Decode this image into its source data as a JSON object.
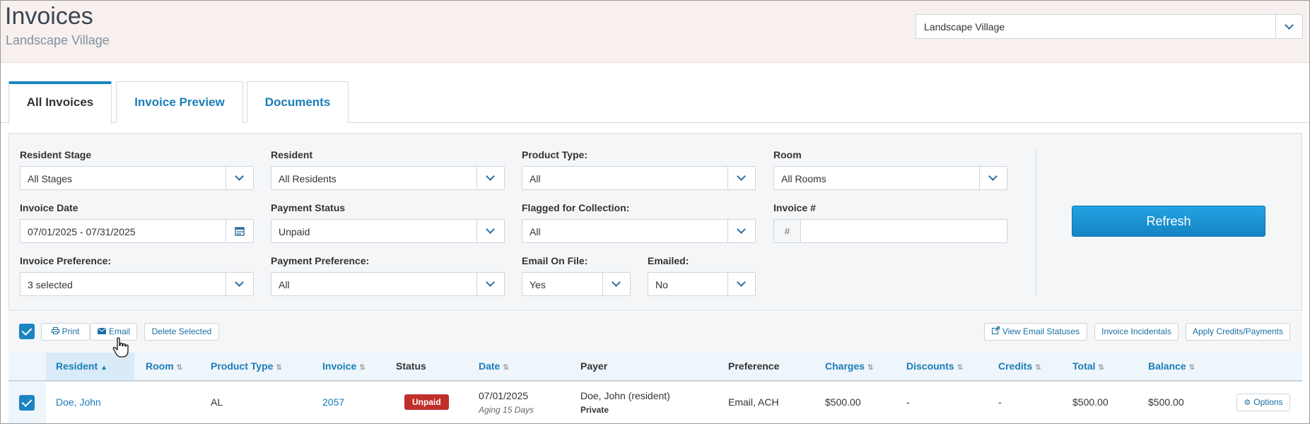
{
  "header": {
    "title": "Invoices",
    "subtitle": "Landscape Village",
    "community_select": "Landscape Village"
  },
  "tabs": [
    {
      "label": "All Invoices",
      "active": true
    },
    {
      "label": "Invoice Preview",
      "active": false
    },
    {
      "label": "Documents",
      "active": false
    }
  ],
  "filters": {
    "resident_stage": {
      "label": "Resident Stage",
      "value": "All Stages"
    },
    "resident": {
      "label": "Resident",
      "value": "All Residents"
    },
    "product_type": {
      "label": "Product Type:",
      "value": "All"
    },
    "room": {
      "label": "Room",
      "value": "All Rooms"
    },
    "invoice_date": {
      "label": "Invoice Date",
      "value": "07/01/2025 - 07/31/2025"
    },
    "payment_status": {
      "label": "Payment Status",
      "value": "Unpaid"
    },
    "flagged_for_collection": {
      "label": "Flagged for Collection:",
      "value": "All"
    },
    "invoice_number": {
      "label": "Invoice #",
      "prefix": "#",
      "value": ""
    },
    "invoice_preference": {
      "label": "Invoice Preference:",
      "value": "3 selected"
    },
    "payment_preference": {
      "label": "Payment Preference:",
      "value": "All"
    },
    "email_on_file": {
      "label": "Email On File:",
      "value": "Yes"
    },
    "emailed": {
      "label": "Emailed:",
      "value": "No"
    },
    "refresh_label": "Refresh"
  },
  "toolbar": {
    "print_label": "Print",
    "email_label": "Email",
    "delete_label": "Delete Selected",
    "view_email_statuses_label": "View Email Statuses",
    "invoice_incidentals_label": "Invoice Incidentals",
    "apply_credits_label": "Apply Credits/Payments"
  },
  "table": {
    "columns": [
      "Resident",
      "Room",
      "Product Type",
      "Invoice",
      "Status",
      "Date",
      "Payer",
      "Preference",
      "Charges",
      "Discounts",
      "Credits",
      "Total",
      "Balance"
    ],
    "rows": [
      {
        "resident": "Doe, John",
        "room": "",
        "product_type": "AL",
        "invoice": "2057",
        "status": "Unpaid",
        "date": "07/01/2025",
        "aging": "Aging 15 Days",
        "payer": "Doe, John (resident)",
        "payer_type": "Private",
        "preference": "Email, ACH",
        "charges": "$500.00",
        "discounts": "-",
        "credits": "-",
        "total": "$500.00",
        "balance": "$500.00",
        "options_label": "Options"
      }
    ]
  },
  "colors": {
    "accent": "#1b84c2",
    "link": "#1a7db8",
    "unpaid_badge": "#c0302b",
    "header_bg": "#f7f0ee"
  }
}
